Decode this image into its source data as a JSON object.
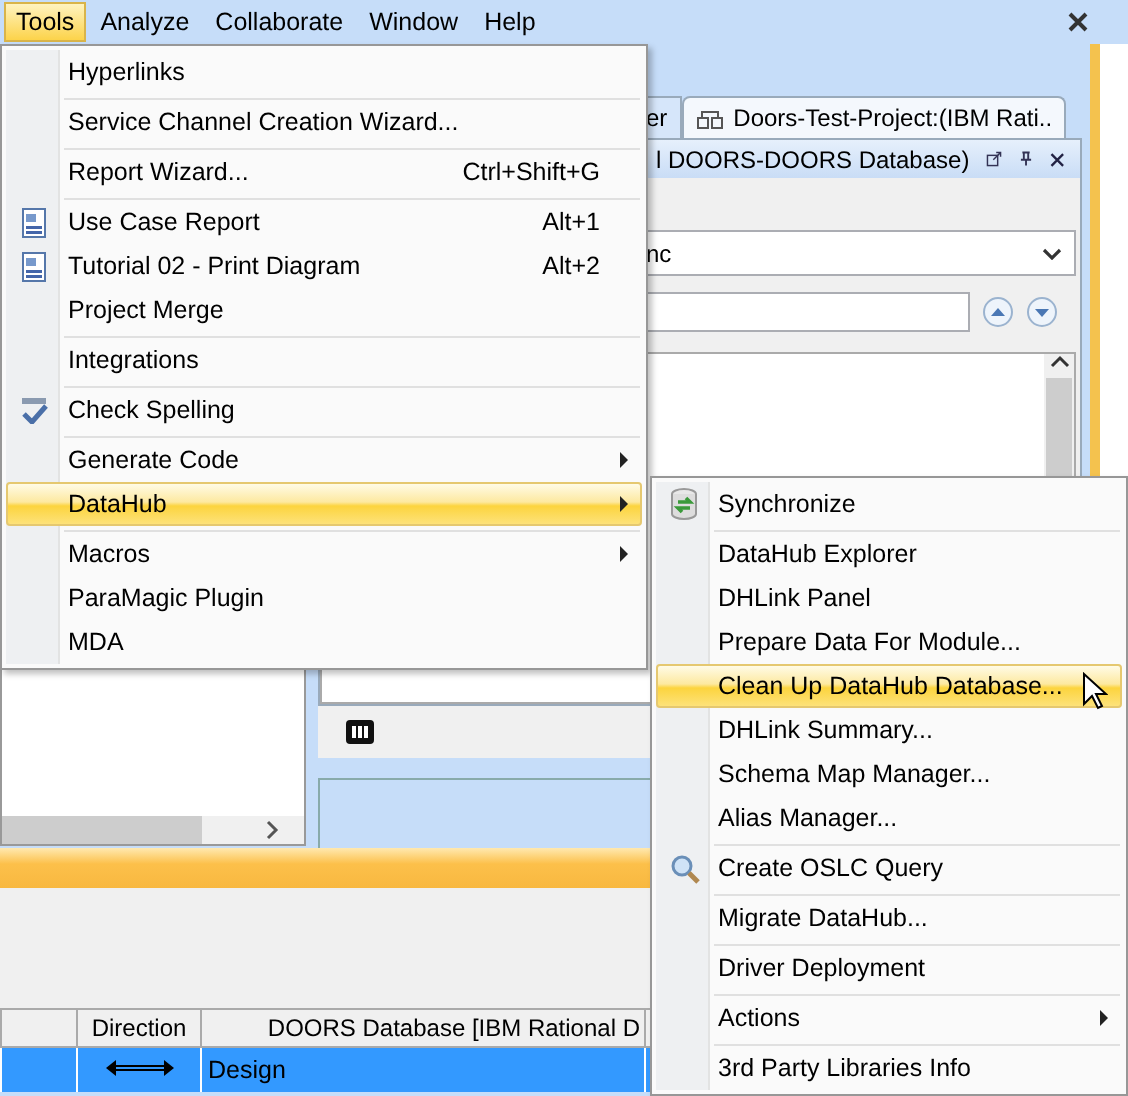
{
  "menubar": {
    "items": [
      {
        "label": "Tools",
        "selected": true
      },
      {
        "label": "Analyze",
        "selected": false
      },
      {
        "label": "Collaborate",
        "selected": false
      },
      {
        "label": "Window",
        "selected": false
      },
      {
        "label": "Help",
        "selected": false
      }
    ]
  },
  "editor": {
    "tabs": [
      {
        "label": "er",
        "selected": false
      },
      {
        "label": "Doors-Test-Project:(IBM Rati..",
        "selected": true
      }
    ],
    "panel_title": "l DOORS-DOORS Database)",
    "combo_value": "nc"
  },
  "table": {
    "columns": [
      "Direction",
      "DOORS Database [IBM Rational D"
    ],
    "rows": [
      {
        "selected": true,
        "cells": [
          "",
          "Design"
        ]
      }
    ]
  },
  "tools_menu": {
    "items": [
      {
        "label": "Hyperlinks",
        "separator_before": false,
        "submenu": false,
        "selected": false
      },
      {
        "label": "Service Channel Creation Wizard...",
        "separator_before": true,
        "submenu": false,
        "selected": false
      },
      {
        "label": "Report Wizard...",
        "shortcut": "Ctrl+Shift+G",
        "separator_before": true,
        "submenu": false,
        "selected": false
      },
      {
        "label": "Use Case Report",
        "shortcut": "Alt+1",
        "separator_before": true,
        "submenu": false,
        "selected": false
      },
      {
        "label": "Tutorial 02 - Print Diagram",
        "shortcut": "Alt+2",
        "separator_before": false,
        "submenu": false,
        "selected": false
      },
      {
        "label": "Project Merge",
        "separator_before": false,
        "submenu": false,
        "selected": false
      },
      {
        "label": "Integrations",
        "separator_before": true,
        "submenu": false,
        "selected": false
      },
      {
        "label": "Check Spelling",
        "separator_before": true,
        "submenu": false,
        "selected": false
      },
      {
        "label": "Generate Code",
        "separator_before": true,
        "submenu": true,
        "selected": false
      },
      {
        "label": "DataHub",
        "separator_before": false,
        "submenu": true,
        "selected": true
      },
      {
        "label": "Macros",
        "separator_before": true,
        "submenu": true,
        "selected": false
      },
      {
        "label": "ParaMagic Plugin",
        "separator_before": false,
        "submenu": false,
        "selected": false
      },
      {
        "label": "MDA",
        "separator_before": false,
        "submenu": false,
        "selected": false
      }
    ]
  },
  "datahub_menu": {
    "items": [
      {
        "label": "Synchronize",
        "separator_before": false,
        "submenu": false,
        "selected": false
      },
      {
        "label": "DataHub Explorer",
        "separator_before": true,
        "submenu": false,
        "selected": false
      },
      {
        "label": "DHLink Panel",
        "separator_before": false,
        "submenu": false,
        "selected": false
      },
      {
        "label": "Prepare Data For Module...",
        "separator_before": false,
        "submenu": false,
        "selected": false
      },
      {
        "label": "Clean Up DataHub Database...",
        "separator_before": false,
        "submenu": false,
        "selected": true
      },
      {
        "label": "DHLink Summary...",
        "separator_before": false,
        "submenu": false,
        "selected": false
      },
      {
        "label": "Schema Map Manager...",
        "separator_before": false,
        "submenu": false,
        "selected": false
      },
      {
        "label": "Alias Manager...",
        "separator_before": false,
        "submenu": false,
        "selected": false
      },
      {
        "label": "Create OSLC Query",
        "separator_before": true,
        "submenu": false,
        "selected": false
      },
      {
        "label": "Migrate DataHub...",
        "separator_before": true,
        "submenu": false,
        "selected": false
      },
      {
        "label": "Driver Deployment",
        "separator_before": true,
        "submenu": false,
        "selected": false
      },
      {
        "label": "Actions",
        "separator_before": true,
        "submenu": true,
        "selected": false
      },
      {
        "label": "3rd Party Libraries Info",
        "separator_before": true,
        "submenu": false,
        "selected": false
      }
    ]
  }
}
